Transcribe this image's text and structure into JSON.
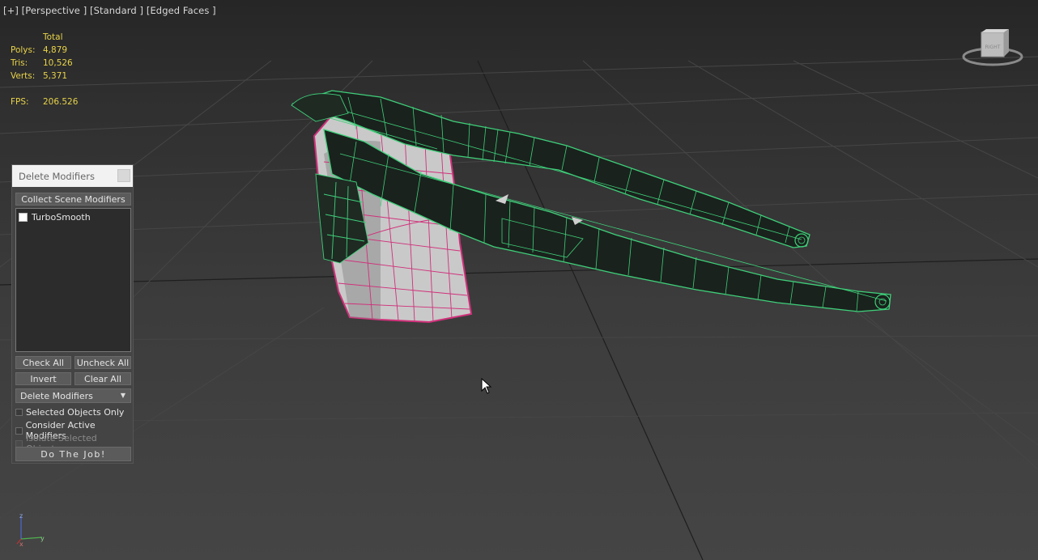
{
  "viewport": {
    "label": "[+] [Perspective ] [Standard ] [Edged Faces ]",
    "stats": {
      "header": "Total",
      "polys_label": "Polys:",
      "polys_value": "4,879",
      "tris_label": "Tris:",
      "tris_value": "10,526",
      "verts_label": "Verts:",
      "verts_value": "5,371",
      "fps_label": "FPS:",
      "fps_value": "206.526"
    },
    "viewcube": {
      "face_label": "RIGHT",
      "icon": "viewcube-icon"
    },
    "axis": {
      "z": "z",
      "y": "y",
      "x": "x"
    }
  },
  "panel": {
    "title": "Delete Modifiers",
    "collect_label": "Collect Scene Modifiers",
    "modifiers": [
      {
        "name": "TurboSmooth",
        "checked": false
      }
    ],
    "check_all_label": "Check All",
    "uncheck_all_label": "Uncheck All",
    "invert_label": "Invert",
    "clear_all_label": "Clear All",
    "mode_selected": "Delete Modifiers",
    "opt_selected_only": "Selected Objects Only",
    "opt_consider_active": "Consider Active Modifiers",
    "opt_isolate": "Isolate Selected Objects",
    "do_job_label": "Do The Job!"
  },
  "colors": {
    "stats_text": "#e8d34a",
    "wire_green": "#3fd07a",
    "wire_magenta": "#d0307a",
    "panel_bg": "#444444"
  }
}
